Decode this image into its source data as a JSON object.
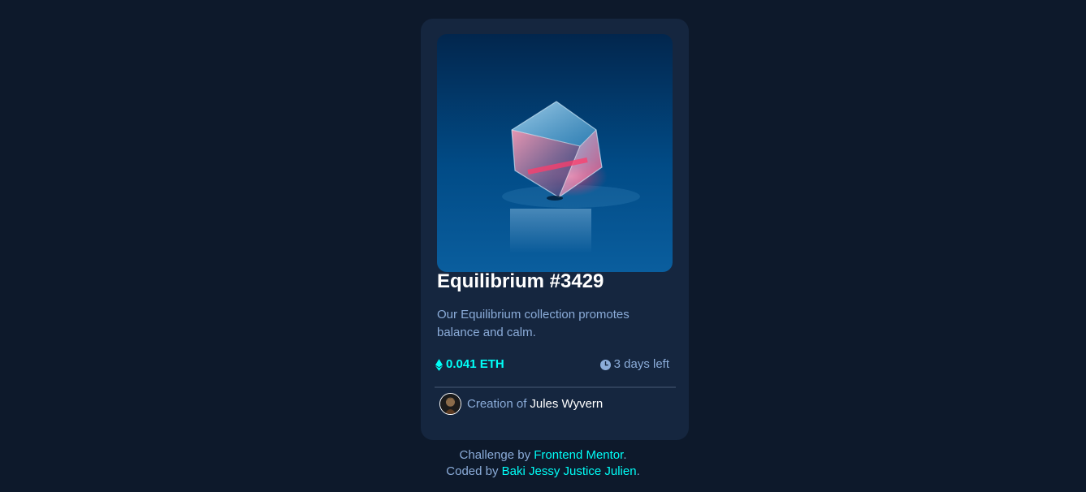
{
  "colors": {
    "page_bg": "#0d192b",
    "card_bg": "#15263f",
    "accent_cyan": "#00fff8",
    "soft_blue": "#8bacd9",
    "white": "#ffffff",
    "divider": "#2e405a"
  },
  "card": {
    "image_name": "equilibrium-cube-image",
    "title": "Equilibrium #3429",
    "description": "Our Equilibrium collection promotes balance and calm.",
    "price": {
      "icon": "ethereum-icon",
      "value": "0.041 ETH"
    },
    "time": {
      "icon": "clock-icon",
      "value": "3 days left"
    },
    "creator": {
      "avatar": "creator-avatar",
      "prefix": "Creation of",
      "name": "Jules Wyvern"
    }
  },
  "attribution": {
    "line1_prefix": "Challenge by",
    "line1_link": "Frontend Mentor",
    "line1_suffix": ".",
    "line2_prefix": "Coded by",
    "line2_link": "Baki Jessy Justice Julien",
    "line2_suffix": "."
  }
}
